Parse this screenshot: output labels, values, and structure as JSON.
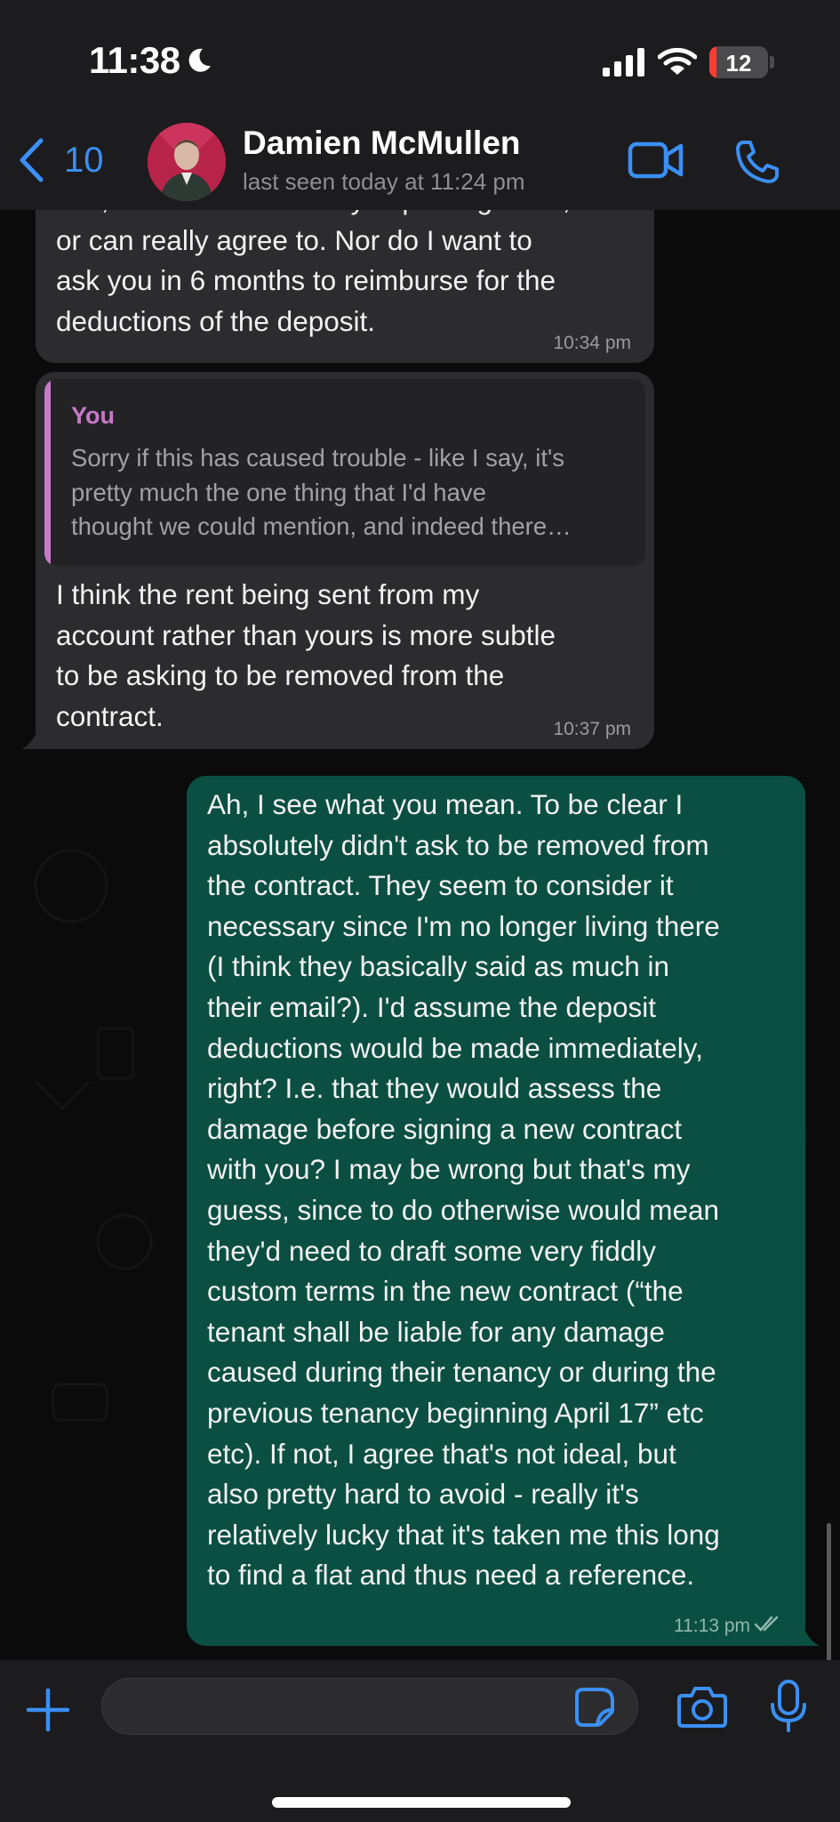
{
  "status_bar": {
    "time": "11:38",
    "battery": "12",
    "battery_level": 0.12
  },
  "header": {
    "back_count": "10",
    "contact_name": "Damien McMullen",
    "last_seen": "last seen today at 11:24 pm"
  },
  "messages": [
    {
      "direction": "incoming",
      "text": "half, which I wasn't really expecting to do,\nor can really agree to. Nor do I want to\nask you in 6 months to reimburse for the\ndeductions of the deposit.",
      "time": "10:34 pm"
    },
    {
      "direction": "incoming",
      "quote_author": "You",
      "quote_text": "Sorry if this has caused trouble - like I say, it's\npretty much the one thing that I'd have\nthought we could mention, and indeed there…",
      "text": "I think the rent being sent from my\naccount rather than yours is more  subtle\nto be asking to be removed from the\ncontract.",
      "time": "10:37 pm"
    },
    {
      "direction": "outgoing",
      "text": "Ah, I see what you mean. To be clear I\nabsolutely didn't ask to be removed from\nthe contract. They seem to consider it\nnecessary since I'm no longer living there\n(I think they basically said as much in\ntheir email?). I'd assume the deposit\ndeductions would be made immediately,\nright? I.e. that they would assess the\ndamage before signing a new contract\nwith you? I may be wrong but that's my\nguess, since to do otherwise would mean\nthey'd need to draft some very fiddly\ncustom terms in the new contract (“the\ntenant shall be liable for any damage\ncaused during their tenancy or during the\nprevious tenancy beginning April 17” etc\netc). If not, I agree that's not ideal, but\nalso pretty hard to avoid - really it's\nrelatively lucky that it's taken me this long\nto find a flat and thus need a reference.",
      "time": "11:13 pm"
    }
  ],
  "input": {
    "placeholder": ""
  },
  "icons": {
    "back": "chevron-left-icon",
    "video": "video-camera-icon",
    "call": "phone-icon",
    "attach": "plus-icon",
    "sticker": "sticker-icon",
    "camera": "camera-icon",
    "mic": "microphone-icon",
    "read_receipt": "double-check-icon"
  },
  "colors": {
    "accent": "#3b8ff5",
    "incoming_bubble": "#2c2c2e",
    "outgoing_bubble": "#0b4f42",
    "quote_author": "#c679c6",
    "battery_low": "#ff3b30"
  }
}
